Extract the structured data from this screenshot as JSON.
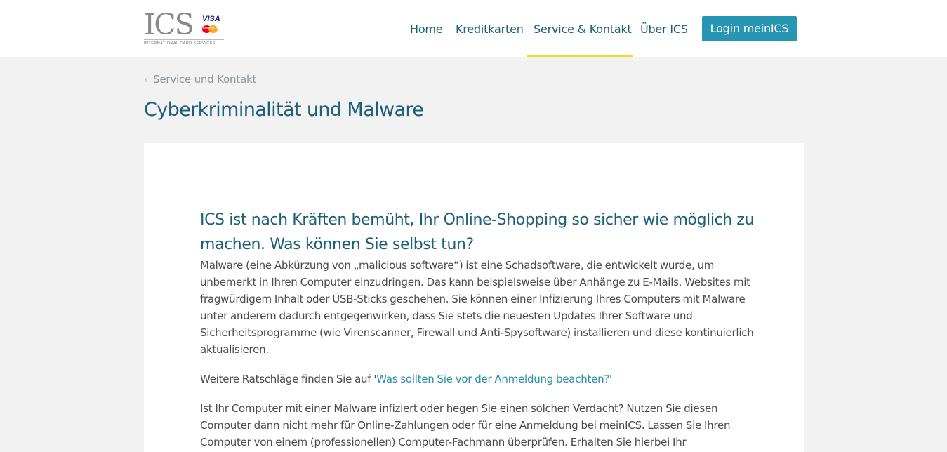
{
  "logo": {
    "brand": "ICS",
    "visa": "VISA",
    "mastercard": "MasterCard",
    "subtitle": "INTERNATIONAL CARD SERVICES"
  },
  "nav": {
    "items": [
      {
        "label": "Home"
      },
      {
        "label": "Kreditkarten"
      },
      {
        "label": "Service & Kontakt"
      },
      {
        "label": "Über ICS"
      }
    ],
    "active_index": 2,
    "login_label": "Login meinICS"
  },
  "breadcrumb": {
    "chevron": "‹",
    "label": "Service und Kontakt"
  },
  "page_title": "Cyberkriminalität und Malware",
  "article": {
    "heading": "ICS ist nach Kräften bemüht, Ihr Online-Shopping so sicher wie möglich zu machen. Was können Sie selbst tun?",
    "paragraph1": "Malware (eine Abkürzung von „malicious software“) ist eine Schadsoftware, die entwickelt wurde, um unbemerkt in Ihren Computer einzudringen. Das kann beispielsweise über Anhänge zu E-Mails, Websites mit fragwürdigem Inhalt oder USB-Sticks geschehen. Sie können einer Infizierung Ihres Computers mit Malware unter anderem dadurch entgegenwirken, dass Sie stets die neuesten Updates Ihrer Software und Sicherheitsprogramme (wie Virenscanner, Firewall und Anti-Spysoftware) installieren und diese kontinuierlich aktualisieren.",
    "paragraph2_prefix": "Weitere Ratschläge finden Sie auf '",
    "paragraph2_link": "Was sollten Sie vor der Anmeldung beachten?",
    "paragraph2_suffix": "'",
    "paragraph3": "Ist Ihr Computer mit einer Malware infiziert oder hegen Sie einen solchen Verdacht? Nutzen Sie diesen Computer dann nicht mehr für Online-Zahlungen oder für eine Anmeldung bei meinICS. Lassen Sie Ihren Computer von einem (professionellen) Computer-Fachmann überprüfen. Erhalten Sie hierbei Ihr"
  },
  "colors": {
    "accent": "#2796b2",
    "title": "#1d5f7a",
    "active_underline": "#e8dd2a",
    "background": "#f2f2f2"
  }
}
